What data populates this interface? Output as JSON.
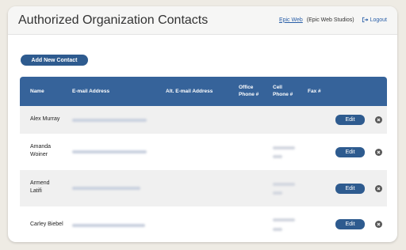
{
  "header": {
    "title": "Authorized Organization Contacts",
    "user_link": "Epic Web",
    "org": "(Epic Web Studios)",
    "logout_label": "Logout"
  },
  "actions": {
    "add_contact_label": "Add New Contact"
  },
  "table": {
    "columns": [
      "Name",
      "E-mail Address",
      "Alt. E-mail Address",
      "Office Phone #",
      "Cell Phone #",
      "Fax #"
    ],
    "rows": [
      {
        "name": "Alex Murray",
        "email": "[redacted]",
        "cell": ""
      },
      {
        "name": "Amanda Woiner",
        "email": "[redacted]",
        "cell": "[redacted]"
      },
      {
        "name": "Armend Latifi",
        "email": "[redacted]",
        "cell": "[redacted]"
      },
      {
        "name": "Carley Biebel",
        "email": "[redacted]",
        "cell": "[redacted]"
      }
    ],
    "edit_label": "Edit"
  },
  "colors": {
    "primary": "#2e5b8f",
    "header_bg": "#36639a",
    "page_bg": "#eeebe4"
  },
  "icons": {
    "logout": "logout-icon",
    "delete": "close-circle-icon"
  }
}
